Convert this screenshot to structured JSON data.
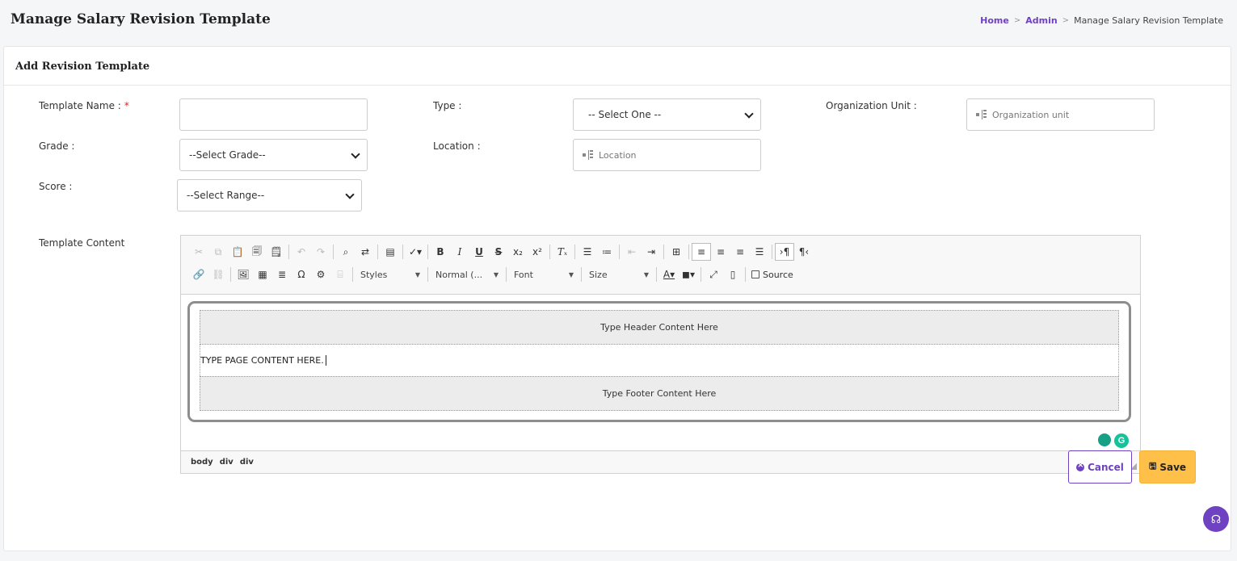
{
  "page": {
    "title": "Manage Salary Revision Template"
  },
  "breadcrumb": {
    "home": "Home",
    "admin": "Admin",
    "current": "Manage Salary Revision Template",
    "separator": ">"
  },
  "card": {
    "title": "Add Revision Template"
  },
  "form": {
    "template_name": {
      "label": "Template Name :",
      "required_mark": "*",
      "value": ""
    },
    "type": {
      "label": "Type :",
      "selected": "-- Select One --"
    },
    "org_unit": {
      "label": "Organization Unit :",
      "placeholder": "Organization unit"
    },
    "grade": {
      "label": "Grade :",
      "selected": "--Select Grade--"
    },
    "location": {
      "label": "Location :",
      "placeholder": "Location"
    },
    "score": {
      "label": "Score :",
      "selected": "--Select Range--"
    },
    "template_content": {
      "label": "Template Content"
    }
  },
  "editor": {
    "combos": {
      "styles": "Styles",
      "format": "Normal (...",
      "font": "Font",
      "size": "Size"
    },
    "source_label": "Source",
    "header_text": "Type Header Content Here",
    "body_text": "TYPE PAGE CONTENT HERE.",
    "footer_text": "Type Footer Content Here",
    "path": [
      "body",
      "div",
      "div"
    ],
    "grammarly_letter": "G"
  },
  "actions": {
    "cancel": "Cancel",
    "save": "Save"
  },
  "colors": {
    "accent": "#6f42c1",
    "save_bg": "#ffc04a",
    "required": "#e02020"
  }
}
